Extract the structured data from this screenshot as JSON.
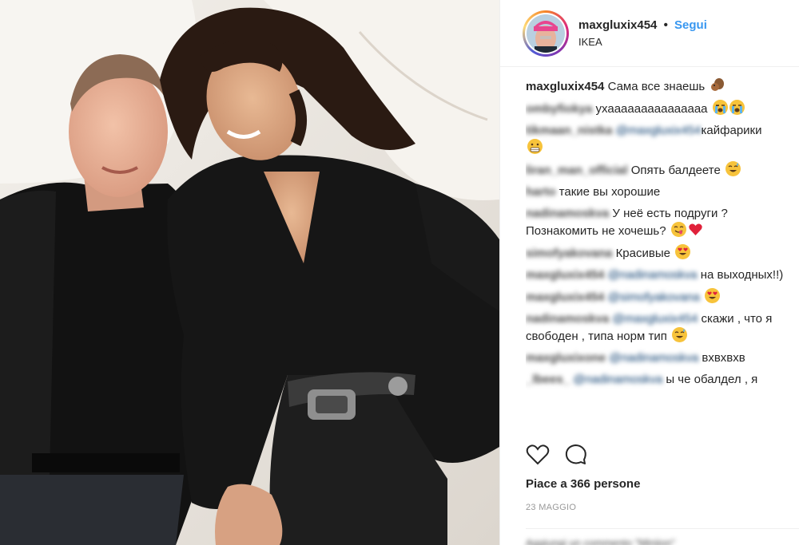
{
  "post": {
    "username": "maxgluxix454",
    "dot": "•",
    "follow_label": "Segui",
    "location": "IKEA"
  },
  "comments": [
    {
      "user": "maxgluxix454",
      "text": "Сама все знаешь",
      "emoji": [
        "squirrel-emoji"
      ]
    },
    {
      "user": "",
      "text": "ухааааааааааааааа",
      "emoji": [
        "crying-emoji",
        "crying-emoji"
      ]
    },
    {
      "user": "",
      "text": "кайфарики",
      "emoji": [
        "grimace-emoji"
      ]
    },
    {
      "user": "",
      "text": "Опять балдеете",
      "emoji": [
        "sweat-smile-emoji"
      ]
    },
    {
      "user": "",
      "text": "такие вы хорошие",
      "emoji": []
    },
    {
      "user": "",
      "text": "У неё есть подруги ? Познакомить не хочешь?",
      "emoji": [
        "yum-emoji",
        "red-heart-emoji"
      ]
    },
    {
      "user": "",
      "text": "Красивые",
      "emoji": [
        "heart-eyes-emoji"
      ]
    },
    {
      "user": "",
      "text": "на выходных!!)",
      "emoji": []
    },
    {
      "user": "",
      "text": "",
      "emoji": [
        "heart-eyes-emoji"
      ]
    },
    {
      "user": "",
      "text": "скажи , что я свободен , типа норм тип",
      "emoji": [
        "sweat-smile-emoji"
      ]
    },
    {
      "user": "",
      "text": "вхвхвхв",
      "emoji": []
    },
    {
      "user": "",
      "text": "ы че обалдел , я",
      "emoji": []
    }
  ],
  "likes_text": "Piace a 366 persone",
  "date_text": "23 MAGGIO",
  "add_comment_placeholder": "",
  "colors": {
    "follow": "#3897f0",
    "text": "#262626",
    "muted": "#999999",
    "border": "#efefef"
  }
}
